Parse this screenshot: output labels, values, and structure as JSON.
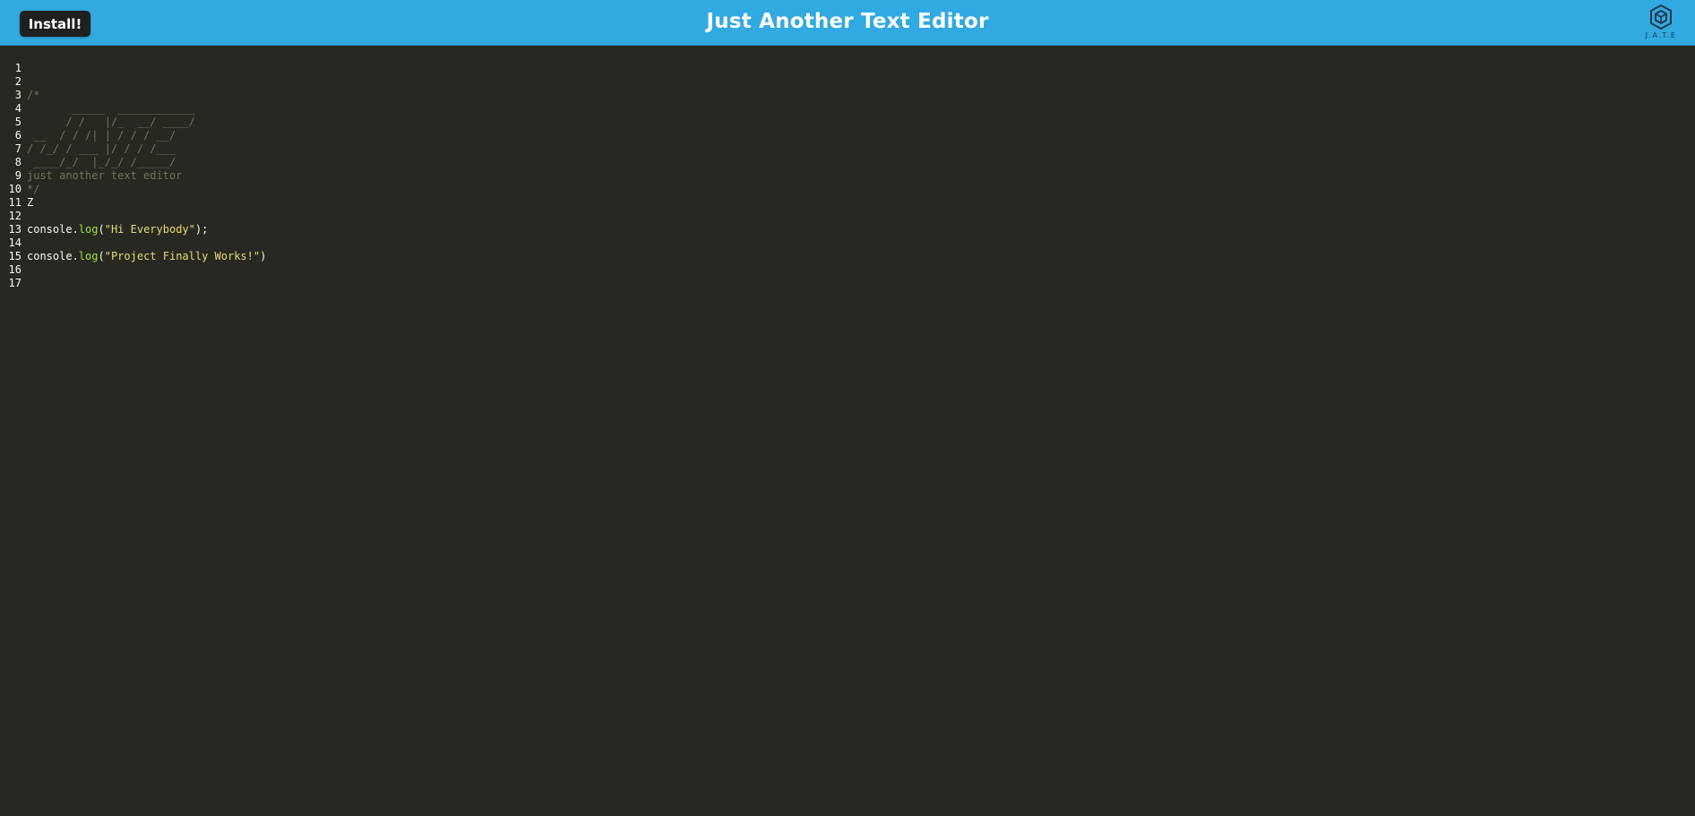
{
  "navbar": {
    "install_label": "Install!",
    "title": "Just Another Text Editor",
    "logo_text": "J.A.T.E",
    "logo_icon": "cube-logo-icon",
    "background_color": "#31a9e1"
  },
  "editor": {
    "theme_background": "#272822",
    "lines": [
      {
        "number": "1"
      },
      {
        "number": "2",
        "comment": "/*"
      },
      {
        "number": "3",
        "comment": "       _____  ____________"
      },
      {
        "number": "4",
        "comment": "      / /   |/_  __/ ____/"
      },
      {
        "number": "5",
        "comment": " __  / / /| | / / / __/"
      },
      {
        "number": "6",
        "comment": "/ /_/ / ___ |/ / / /___"
      },
      {
        "number": "7",
        "comment": " ____/_/  |_/_/ /_____/"
      },
      {
        "number": "8",
        "comment": "just another text editor"
      },
      {
        "number": "9",
        "comment": "*/"
      },
      {
        "number": "10",
        "plain": "Z"
      },
      {
        "number": "11"
      },
      {
        "number": "12",
        "obj": "console.",
        "method": "log",
        "open": "(",
        "str": "\"Hi Everybody\"",
        "close": ");"
      },
      {
        "number": "13"
      },
      {
        "number": "14",
        "obj": "console.",
        "method": "log",
        "open": "(",
        "str": "\"Project Finally Works!\"",
        "close": ")"
      },
      {
        "number": "15"
      },
      {
        "number": "16"
      },
      {
        "number": "17"
      }
    ]
  }
}
